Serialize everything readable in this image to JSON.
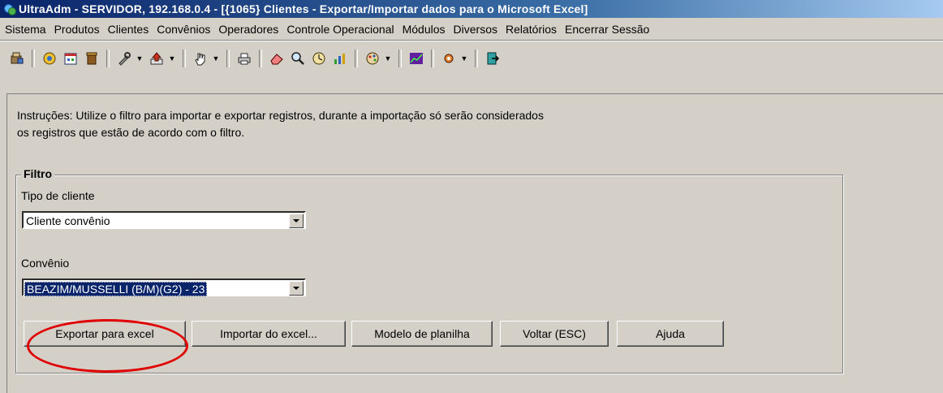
{
  "window": {
    "title": "UltraAdm - SERVIDOR, 192.168.0.4 - [{1065} Clientes - Exportar/Importar dados para o Microsoft Excel]"
  },
  "menu": [
    "Sistema",
    "Produtos",
    "Clientes",
    "Convênios",
    "Operadores",
    "Controle Operacional",
    "Módulos",
    "Diversos",
    "Relatórios",
    "Encerrar Sessão"
  ],
  "toolbar": {
    "icons": [
      "users-icon",
      "globe-icon",
      "calendar-icon",
      "bin-icon",
      "tools-icon",
      "upload-icon",
      "hand-icon",
      "printer-icon",
      "eraser-icon",
      "magnifier-icon",
      "clock-icon",
      "chart-icon",
      "palette-icon",
      "graph-icon",
      "settings-icon",
      "exit-icon"
    ]
  },
  "instructions": {
    "text": "Instruções: Utilize o filtro para importar e exportar registros, durante a importação só serão considerados\nos registros que estão de acordo com o filtro."
  },
  "filter": {
    "legend": "Filtro",
    "client_type_label": "Tipo de cliente",
    "client_type_value": "Cliente convênio",
    "convenio_label": "Convênio",
    "convenio_value": "BEAZIM/MUSSELLI (B/M)(G2) - 23"
  },
  "buttons": {
    "export": "Exportar para excel",
    "import": "Importar do excel...",
    "template": "Modelo de planilha",
    "back": "Voltar (ESC)",
    "help": "Ajuda"
  },
  "colors": {
    "titlebar": "#0a246a",
    "window_bg": "#d4d0c8",
    "annotation": "#e00000",
    "selection": "#0a246a"
  }
}
